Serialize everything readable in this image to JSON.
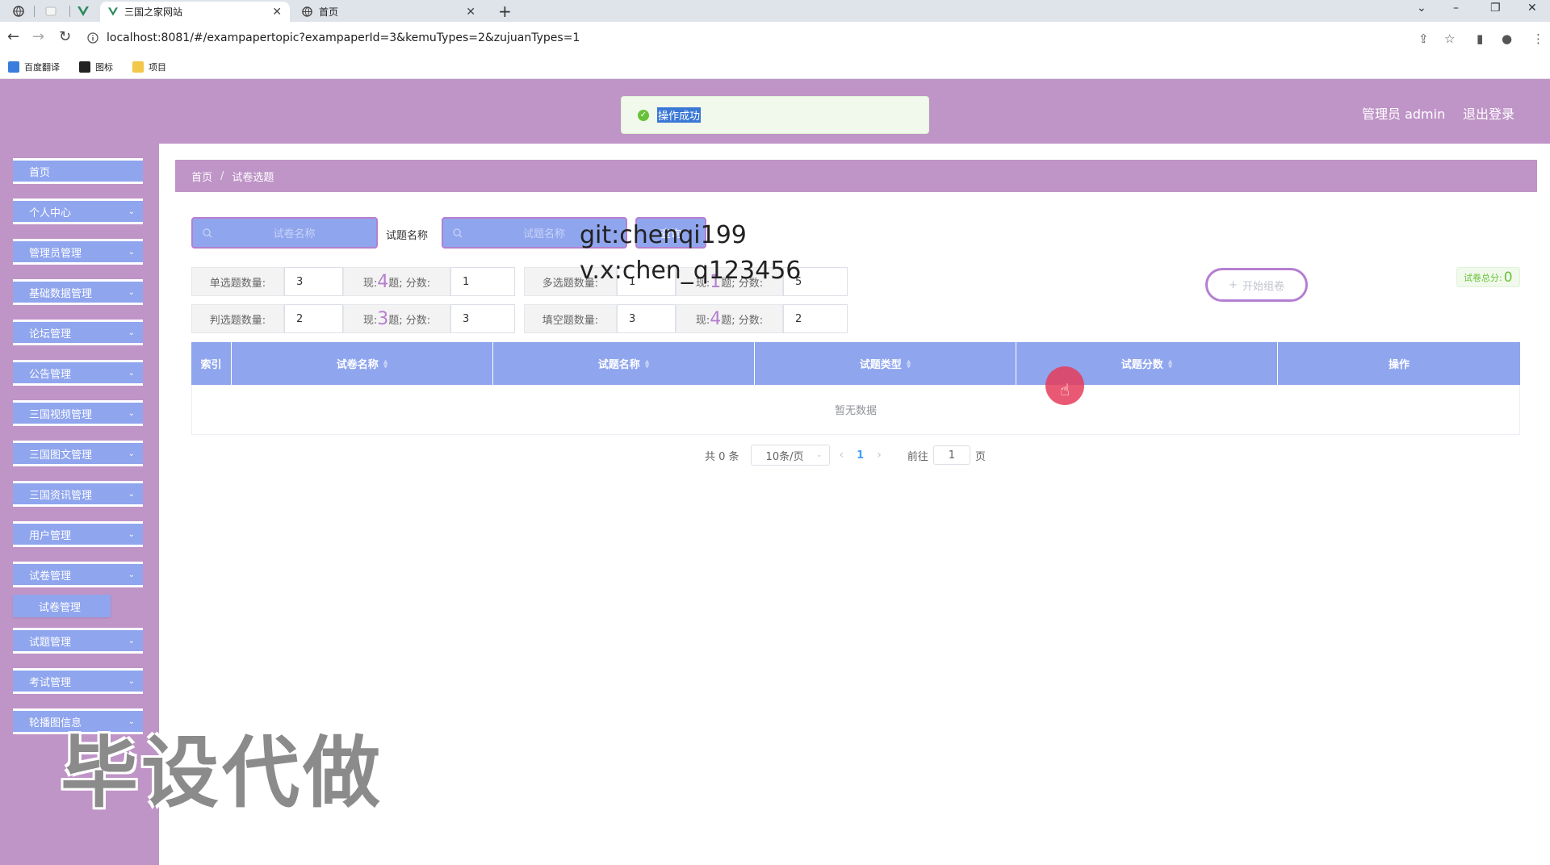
{
  "browser": {
    "tabs": [
      {
        "title": "三国之家网站",
        "active": true
      },
      {
        "title": "首页",
        "active": false
      }
    ],
    "url": "localhost:8081/#/exampapertopic?exampaperId=3&kemuTypes=2&zujuanTypes=1",
    "bookmarks": [
      "百度翻译",
      "图标",
      "项目"
    ]
  },
  "header": {
    "toast": "操作成功",
    "user": "管理员 admin",
    "logout": "退出登录"
  },
  "sidebar": {
    "items": [
      {
        "label": "首页",
        "has_children": false
      },
      {
        "label": "个人中心",
        "has_children": true
      },
      {
        "label": "管理员管理",
        "has_children": true
      },
      {
        "label": "基础数据管理",
        "has_children": true
      },
      {
        "label": "论坛管理",
        "has_children": true
      },
      {
        "label": "公告管理",
        "has_children": true
      },
      {
        "label": "三国视频管理",
        "has_children": true
      },
      {
        "label": "三国图文管理",
        "has_children": true
      },
      {
        "label": "三国资讯管理",
        "has_children": true
      },
      {
        "label": "用户管理",
        "has_children": true
      },
      {
        "label": "试卷管理",
        "has_children": true
      },
      {
        "label": "试题管理",
        "has_children": true
      },
      {
        "label": "考试管理",
        "has_children": true
      },
      {
        "label": "轮播图信息",
        "has_children": true
      }
    ],
    "submenu": {
      "label": "试卷管理"
    }
  },
  "breadcrumb": {
    "home": "首页",
    "current": "试卷选题"
  },
  "search": {
    "paper_placeholder": "试卷名称",
    "label": "试题名称",
    "question_placeholder": "试题名称",
    "button": "查询"
  },
  "config": {
    "single": {
      "label": "单选题数量:",
      "count": "3",
      "current": "4",
      "score": "1"
    },
    "multi": {
      "label": "多选题数量:",
      "count": "1",
      "current": "1",
      "score": "5"
    },
    "judge": {
      "label": "判选题数量:",
      "count": "2",
      "current": "3",
      "score": "3"
    },
    "fill": {
      "label": "填空题数量:",
      "count": "3",
      "current": "4",
      "score": "2"
    },
    "note_prefix": "现:",
    "note_middle": "题;  分数:"
  },
  "actions": {
    "start": "开始组卷",
    "total_label": "试卷总分:",
    "total_value": "0"
  },
  "table": {
    "columns": [
      "索引",
      "试卷名称",
      "试题名称",
      "试题类型",
      "试题分数",
      "操作"
    ],
    "sortable": [
      false,
      true,
      true,
      true,
      true,
      false
    ],
    "empty_text": "暂无数据"
  },
  "pagination": {
    "total": "共 0 条",
    "page_size": "10条/页",
    "current_page": "1",
    "goto_prefix": "前往",
    "goto_value": "1",
    "goto_suffix": "页"
  },
  "overlay": {
    "line1": "git:chenqi199",
    "line2": "v.x:chen_q123456",
    "watermark": "毕设代做"
  },
  "colors": {
    "purple": "#bf94c7",
    "blue": "#8fa5ee",
    "success": "#67c23a"
  }
}
